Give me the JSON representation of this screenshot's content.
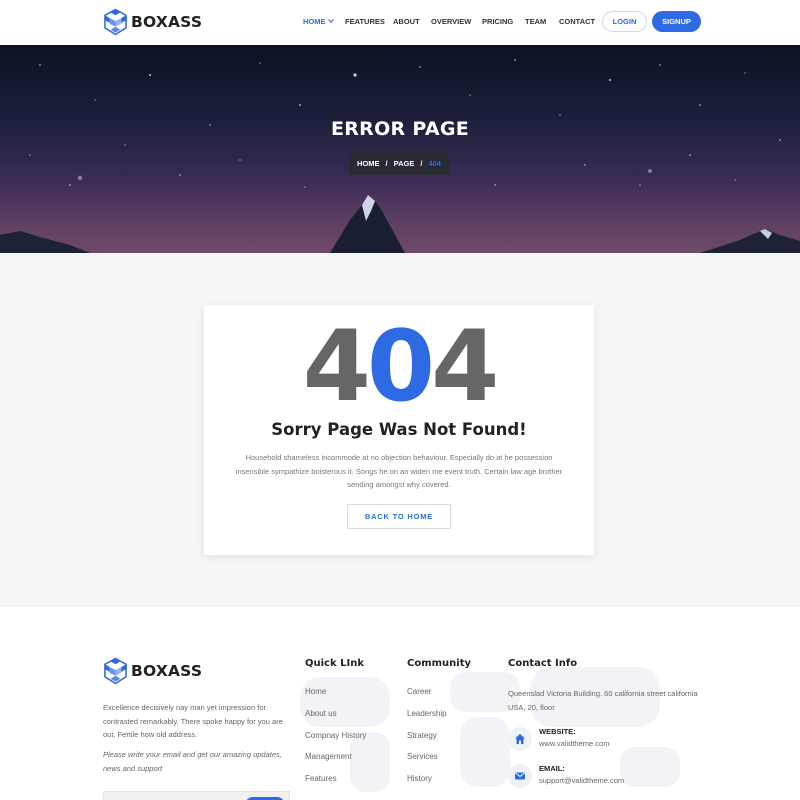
{
  "brand": {
    "name": "BOXASS"
  },
  "nav": {
    "items": [
      {
        "label": "HOME",
        "active": true
      },
      {
        "label": "FEATURES"
      },
      {
        "label": "ABOUT"
      },
      {
        "label": "OVERVIEW"
      },
      {
        "label": "PRICING"
      },
      {
        "label": "TEAM"
      },
      {
        "label": "CONTACT"
      }
    ],
    "login_label": "LOGIN",
    "signup_label": "SIGNUP"
  },
  "banner": {
    "title": "ERROR PAGE",
    "breadcrumb": [
      "HOME",
      "/",
      "PAGE",
      "/",
      "404"
    ]
  },
  "error": {
    "code_left": "4",
    "code_mid": "0",
    "code_right": "4",
    "heading": "Sorry Page Was Not Found!",
    "description": "Household shameless incommode at no objection behaviour. Especially do at he possession insensible sympathize boisterous it. Songs he on an widen me event truth. Certain law age brother sending amongst why covered.",
    "button_label": "BACK TO HOME"
  },
  "footer": {
    "about": "Excellence decisively nay man yet impression for contrasted remarkably. There spoke happy for you are out. Fertile how old address.",
    "newsletter_note": "Please write your email and get our amazing updates, news and support",
    "quick_link": {
      "title": "Quick LInk",
      "items": [
        "Home",
        "About us",
        "Compnay History",
        "Management",
        "Features"
      ]
    },
    "community": {
      "title": "Community",
      "items": [
        "Career",
        "Leadership",
        "Strategy",
        "Services",
        "History"
      ]
    },
    "contact": {
      "title": "Contact Info",
      "address": "Queenslad Victoria Building. 60 california street california USA, 20, floor",
      "website_label": "WEBSITE:",
      "website_value": "www.validtheme.com",
      "email_label": "EMAIL:",
      "email_value": "support@validtheme.com"
    }
  },
  "colors": {
    "accent": "#2d6ae3",
    "dark": "#222222",
    "code_grey": "#666666"
  }
}
